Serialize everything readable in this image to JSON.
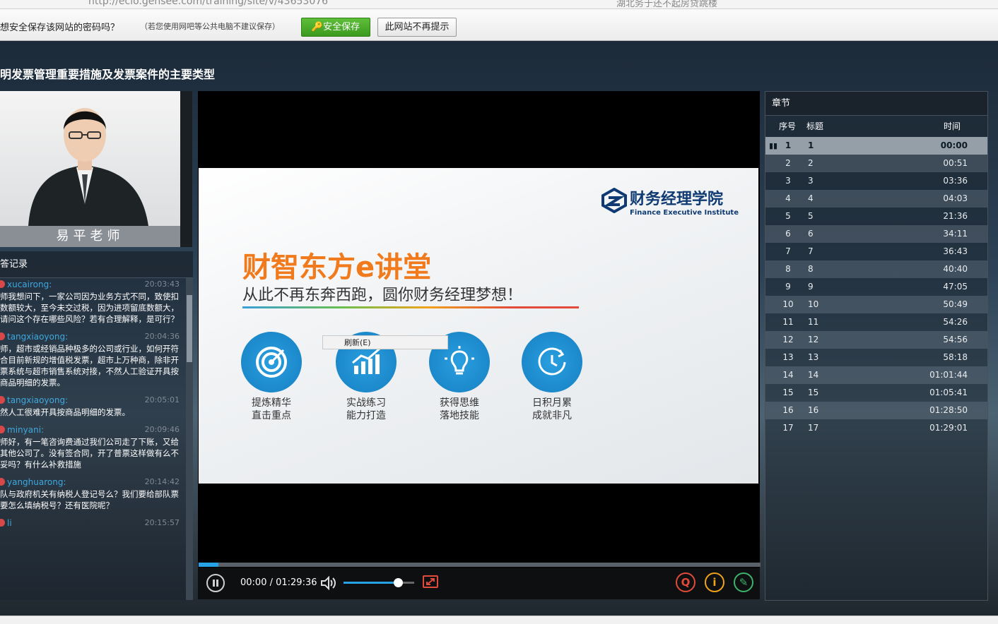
{
  "browser": {
    "url": "http://ecio.gensee.com/training/site/v/43653076",
    "search_text": "湖北务于还不起房贷跳楼"
  },
  "password_bar": {
    "question": "想安全保存该网站的密码吗？",
    "hint": "（若您使用网吧等公共电脑不建议保存）",
    "save_label": "安全保存",
    "never_label": "此网站不再提示"
  },
  "course": {
    "title": "明发票管理重要措施及发票案件的主要类型"
  },
  "teacher": {
    "caption": "易平老师"
  },
  "qa": {
    "header": "答记录",
    "messages": [
      {
        "user": "xucairong:",
        "time": "20:03:43",
        "text": "师我想问下，一家公司因为业务方式不同，致使扣数额较大，至今未交过税，因为进项留底数额大，请问这个存在哪些风险？若有合理解释，是可行？"
      },
      {
        "user": "tangxiaoyong:",
        "time": "20:04:36",
        "text": "师，超市或经销品种极多的公司或行业，如何开符合目前新规的增值税发票，超市上万种商，除非开票系统与超市销售系统对接，不然人工验证开具按商品明细的发票。"
      },
      {
        "user": "tangxiaoyong:",
        "time": "20:05:01",
        "text": "然人工很难开具按商品明细的发票。"
      },
      {
        "user": "minyani:",
        "time": "20:09:46",
        "text": "师好，有一笔咨询费通过我们公司走了下账，又给其他公司了。没有签合同，开了普票这样做有么不妥吗？有什么补救措施"
      },
      {
        "user": "yanghuarong:",
        "time": "20:14:42",
        "text": "队与政府机关有纳税人登记号么？我们要给部队票要怎么填纳税号？还有医院呢？"
      },
      {
        "user": "li",
        "time": "20:15:57",
        "text": ""
      }
    ]
  },
  "slide": {
    "logo_cn": "财务经理学院",
    "logo_en": "Finance Executive Institute",
    "headline": "财智东方e讲堂",
    "subline": "从此不再东奔西跑，圆你财务经理梦想！",
    "features": [
      {
        "line1": "提炼精华",
        "line2": "直击重点",
        "icon": "target-icon"
      },
      {
        "line1": "实战练习",
        "line2": "能力打造",
        "icon": "chart-icon"
      },
      {
        "line1": "获得思维",
        "line2": "落地技能",
        "icon": "lightbulb-icon"
      },
      {
        "line1": "日积月累",
        "line2": "成就非凡",
        "icon": "clock-icon"
      }
    ],
    "context_menu": "刷新(E)"
  },
  "player": {
    "timecode": "00:00 / 01:29:36",
    "progress_fraction": 0.035,
    "volume_fraction": 0.78
  },
  "chapters": {
    "header": "章节",
    "col_num": "序号",
    "col_title": "标题",
    "col_time": "时间",
    "rows": [
      {
        "n": "1",
        "t": "1",
        "tm": "00:00"
      },
      {
        "n": "2",
        "t": "2",
        "tm": "00:51"
      },
      {
        "n": "3",
        "t": "3",
        "tm": "03:36"
      },
      {
        "n": "4",
        "t": "4",
        "tm": "04:03"
      },
      {
        "n": "5",
        "t": "5",
        "tm": "21:36"
      },
      {
        "n": "6",
        "t": "6",
        "tm": "34:11"
      },
      {
        "n": "7",
        "t": "7",
        "tm": "36:43"
      },
      {
        "n": "8",
        "t": "8",
        "tm": "40:40"
      },
      {
        "n": "9",
        "t": "9",
        "tm": "47:05"
      },
      {
        "n": "10",
        "t": "10",
        "tm": "50:49"
      },
      {
        "n": "11",
        "t": "11",
        "tm": "54:26"
      },
      {
        "n": "12",
        "t": "12",
        "tm": "54:56"
      },
      {
        "n": "13",
        "t": "13",
        "tm": "58:18"
      },
      {
        "n": "14",
        "t": "14",
        "tm": "01:01:44"
      },
      {
        "n": "15",
        "t": "15",
        "tm": "01:05:41"
      },
      {
        "n": "16",
        "t": "16",
        "tm": "01:28:50"
      },
      {
        "n": "17",
        "t": "17",
        "tm": "01:29:01"
      }
    ]
  }
}
